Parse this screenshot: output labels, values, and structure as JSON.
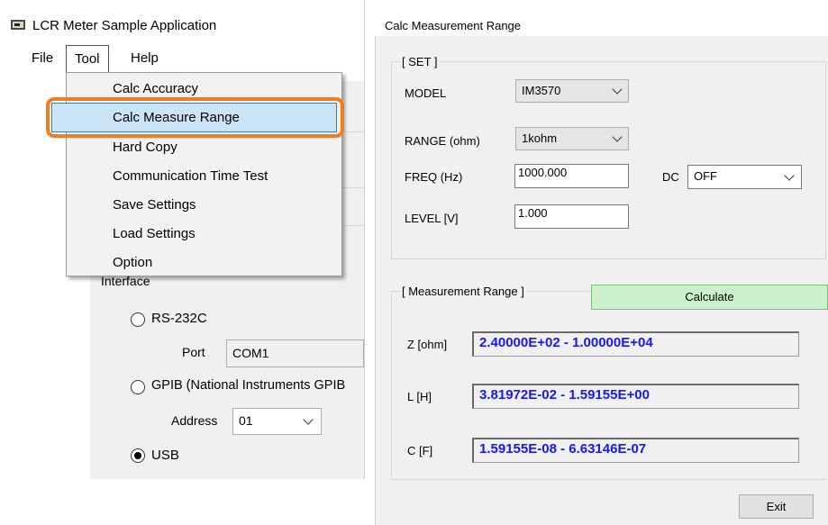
{
  "left_window": {
    "title": "LCR Meter Sample Application",
    "menu": {
      "file": "File",
      "tool": "Tool",
      "help": "Help"
    },
    "tool_menu_items": [
      "Calc Accuracy",
      "Calc Measure Range",
      "Hard Copy",
      "Communication Time Test",
      "Save Settings",
      "Load Settings",
      "Option"
    ],
    "highlighted_item": "Calc Measure Range",
    "callout_color": "#ef7d22",
    "interface": {
      "label": "Interface",
      "rs232c": {
        "label": "RS-232C",
        "port_label": "Port",
        "port_value": "COM1"
      },
      "gpib": {
        "label": "GPIB (National Instruments GPIB",
        "address_label": "Address",
        "address_value": "01"
      },
      "usb": {
        "label": "USB",
        "selected": true
      }
    }
  },
  "right_window": {
    "title": "Calc Measurement Range",
    "set_group": {
      "legend": "[ SET ]",
      "model_label": "MODEL",
      "model_value": "IM3570",
      "range_label": "RANGE (ohm)",
      "range_value": "1kohm",
      "freq_label": "FREQ (Hz)",
      "freq_value": "1000.000",
      "dc_label": "DC",
      "dc_value": "OFF",
      "level_label": "LEVEL [V]",
      "level_value": "1.000"
    },
    "measurement_group": {
      "legend": "[ Measurement Range ]",
      "calculate_label": "Calculate",
      "calculate_color": "#ccf0cc",
      "rows": [
        {
          "label": "Z [ohm]",
          "value": "2.40000E+02 - 1.00000E+04"
        },
        {
          "label": "L [H]",
          "value": "3.81972E-02 - 1.59155E+00"
        },
        {
          "label": "C [F]",
          "value": "1.59155E-08 - 6.63146E-07"
        }
      ],
      "result_color": "#1717ff"
    },
    "exit_label": "Exit"
  }
}
